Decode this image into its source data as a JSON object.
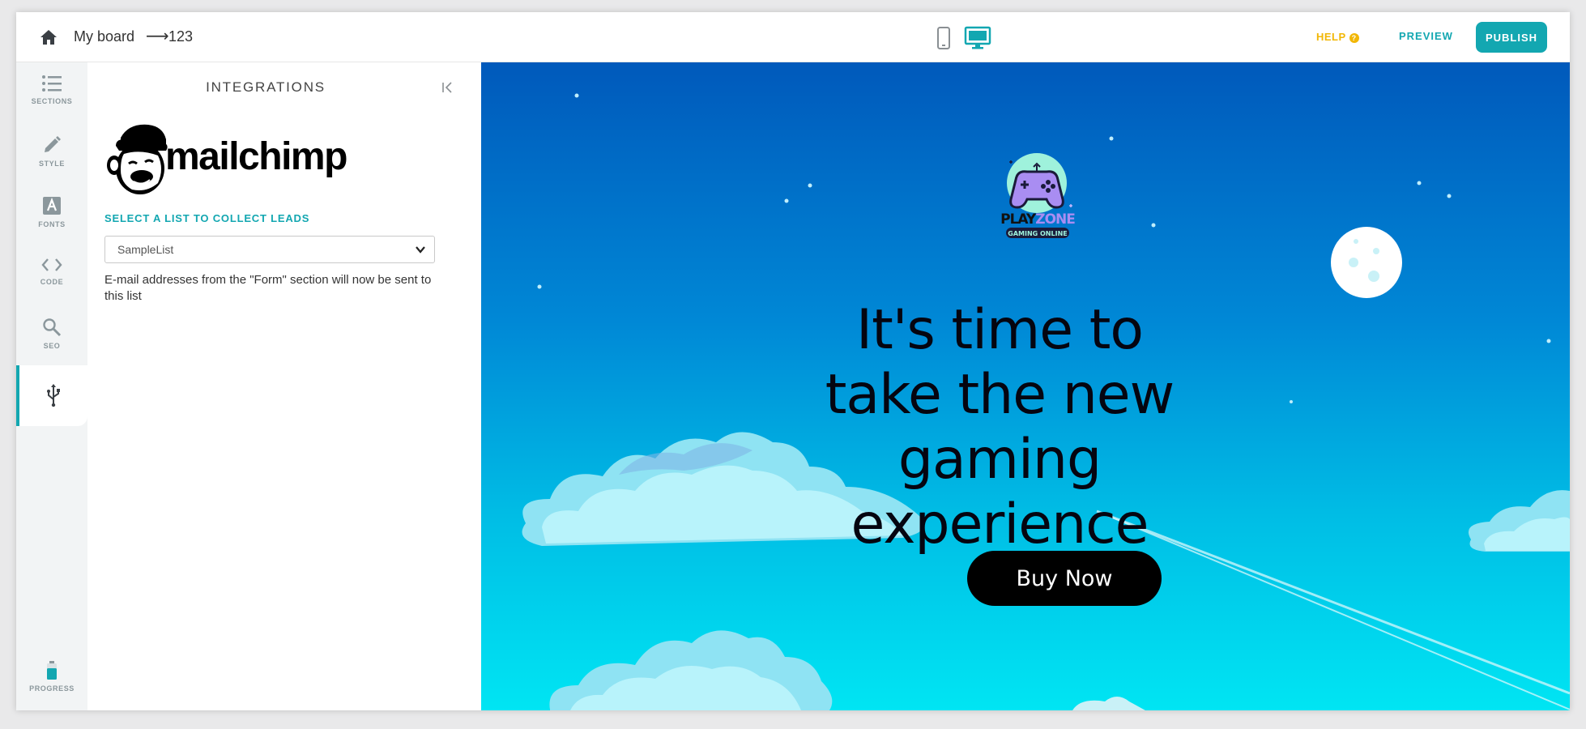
{
  "breadcrumb": {
    "board": "My board",
    "arrow": "⟶",
    "page": "123"
  },
  "header": {
    "help_label": "HELP",
    "help_mark": "?",
    "preview_label": "PREVIEW",
    "publish_label": "PUBLISH"
  },
  "rail": {
    "items": [
      {
        "label": "SECTIONS",
        "icon": "list-icon"
      },
      {
        "label": "STYLE",
        "icon": "pencil-icon"
      },
      {
        "label": "FONTS",
        "icon": "font-icon"
      },
      {
        "label": "CODE",
        "icon": "code-icon"
      },
      {
        "label": "SEO",
        "icon": "magnifier-icon"
      },
      {
        "label": "",
        "icon": "usb-icon",
        "active": true
      }
    ],
    "progress_label": "PROGRESS"
  },
  "panel": {
    "title": "INTEGRATIONS",
    "logo_text": "mailchimp",
    "select_label": "SELECT A LIST TO COLLECT LEADS",
    "select_value": "SampleList",
    "note": "E-mail addresses from the \"Form\" section will now be sent to this list"
  },
  "canvas": {
    "logo_main": "PLAY ZONE",
    "logo_play": "PLAY",
    "logo_zone": "ZONE",
    "logo_sub": "GAMING ONLINE",
    "headline": "It's time to take the new gaming experience",
    "cta_label": "Buy Now"
  },
  "colors": {
    "accent": "#13a7b1",
    "help": "#f2b705",
    "cta": "#000000",
    "sky_top": "#0059bb",
    "sky_bottom": "#00e5f3"
  }
}
